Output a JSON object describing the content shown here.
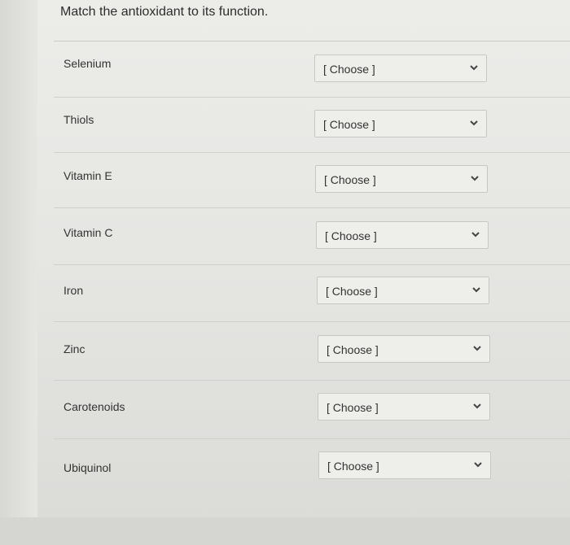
{
  "question": {
    "title": "Match the antioxidant to its function."
  },
  "rows": [
    {
      "term": "Selenium",
      "select": "[ Choose ]"
    },
    {
      "term": "Thiols",
      "select": "[ Choose ]"
    },
    {
      "term": "Vitamin E",
      "select": "[ Choose ]"
    },
    {
      "term": "Vitamin C",
      "select": "[ Choose ]"
    },
    {
      "term": "Iron",
      "select": "[ Choose ]"
    },
    {
      "term": "Zinc",
      "select": "[ Choose ]"
    },
    {
      "term": "Carotenoids",
      "select": "[ Choose ]"
    },
    {
      "term": "Ubiquinol",
      "select": "[ Choose ]"
    }
  ],
  "icons": {
    "dropdown": "chevron-down-icon"
  },
  "colors": {
    "background": "#e6e6e3",
    "text": "#2d2d2d",
    "select_bg": "#eeeeeb",
    "border": "#c7c7c4"
  }
}
